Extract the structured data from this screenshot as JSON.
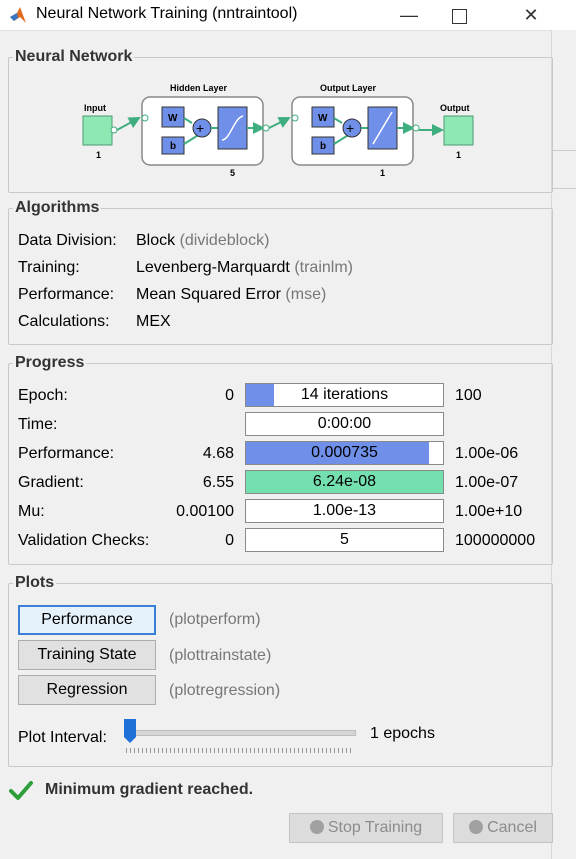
{
  "window": {
    "title": "Neural Network Training (nntraintool)"
  },
  "neural_network": {
    "legend": "Neural Network",
    "input_label": "Input",
    "input_size": "1",
    "hidden_label": "Hidden Layer",
    "hidden_size": "5",
    "output_layer_label": "Output Layer",
    "output_layer_size": "1",
    "output_label": "Output",
    "output_size": "1",
    "w": "W",
    "b": "b",
    "plus": "+"
  },
  "algorithms": {
    "legend": "Algorithms",
    "rows": [
      {
        "label": "Data Division:",
        "value": "Block",
        "fn": "(divideblock)"
      },
      {
        "label": "Training:",
        "value": "Levenberg-Marquardt",
        "fn": "(trainlm)"
      },
      {
        "label": "Performance:",
        "value": "Mean Squared Error",
        "fn": "(mse)"
      },
      {
        "label": "Calculations:",
        "value": "MEX",
        "fn": ""
      }
    ]
  },
  "progress": {
    "legend": "Progress",
    "rows": [
      {
        "label": "Epoch:",
        "start": "0",
        "value": "14 iterations",
        "end": "100",
        "fill_fraction": 0.14,
        "fill_color": "#6f8fe8"
      },
      {
        "label": "Time:",
        "start": "",
        "value": "0:00:00",
        "end": "",
        "fill_fraction": 0,
        "fill_color": "#6f8fe8"
      },
      {
        "label": "Performance:",
        "start": "4.68",
        "value": "0.000735",
        "end": "1.00e-06",
        "fill_fraction": 0.93,
        "fill_color": "#6f8fe8"
      },
      {
        "label": "Gradient:",
        "start": "6.55",
        "value": "6.24e-08",
        "end": "1.00e-07",
        "fill_fraction": 1.0,
        "fill_color": "#74e0b0"
      },
      {
        "label": "Mu:",
        "start": "0.00100",
        "value": "1.00e-13",
        "end": "1.00e+10",
        "fill_fraction": 0,
        "fill_color": "#6f8fe8"
      },
      {
        "label": "Validation Checks:",
        "start": "0",
        "value": "5",
        "end": "100000000",
        "fill_fraction": 0,
        "fill_color": "#6f8fe8"
      }
    ]
  },
  "plots": {
    "legend": "Plots",
    "buttons": [
      {
        "label": "Performance",
        "fn": "(plotperform)"
      },
      {
        "label": "Training State",
        "fn": "(plottrainstate)"
      },
      {
        "label": "Regression",
        "fn": "(plotregression)"
      }
    ],
    "interval_label": "Plot Interval:",
    "interval_value": "1 epochs",
    "slider_fraction": 0.0
  },
  "status": {
    "message": "Minimum gradient reached."
  },
  "footer": {
    "stop_label": "Stop Training",
    "cancel_label": "Cancel"
  },
  "colors": {
    "accent": "#3c7fd4",
    "block_blue": "#6f8fe8",
    "io_green": "#8ee8b4",
    "grad_green": "#74e0b0",
    "check_green": "#2e9e3a"
  },
  "icons": {
    "app": "matlab-logo-icon",
    "minimize": "minimize-icon",
    "maximize": "maximize-icon",
    "close": "close-icon",
    "status": "checkmark-icon",
    "stop": "stop-icon",
    "cancel": "cancel-icon"
  }
}
